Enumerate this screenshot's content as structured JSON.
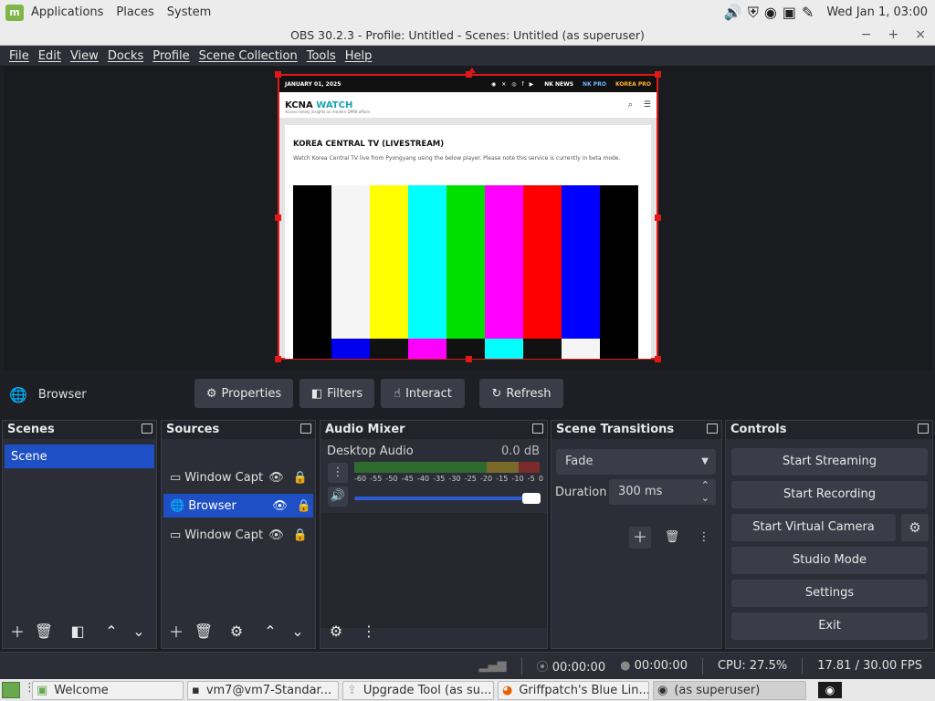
{
  "desktop": {
    "menus": [
      "Applications",
      "Places",
      "System"
    ],
    "clock": "Wed Jan  1, 03:00"
  },
  "window": {
    "title": "OBS 30.2.3 - Profile: Untitled - Scenes: Untitled (as superuser)",
    "controls": [
      "−",
      "+",
      "×"
    ]
  },
  "menubar": [
    "File",
    "Edit",
    "View",
    "Docks",
    "Profile",
    "Scene Collection",
    "Tools",
    "Help"
  ],
  "preview": {
    "website": {
      "date": "JANUARY 01, 2025",
      "brands": [
        "NK NEWS",
        "NK PRO",
        "KOREA PRO"
      ],
      "logo_main": "KCNA",
      "logo_accent": "WATCH",
      "tagline": "Access timely insights on modern DPRK affairs",
      "headline": "KOREA CENTRAL TV (LIVESTREAM)",
      "description": "Watch Korea Central TV live from Pyongyang using the below player. Please note this service is currently in beta mode.",
      "colorbars": [
        "#000000",
        "#f5f5f5",
        "#ffff00",
        "#00ffff",
        "#00e000",
        "#ff00ff",
        "#ff0000",
        "#0000ff",
        "#000000"
      ],
      "colorbars_low": [
        "#000000",
        "#0000ee",
        "#111111",
        "#ff00ff",
        "#111111",
        "#00ffff",
        "#111111",
        "#f5f5f5",
        "#000000"
      ]
    }
  },
  "source_toolbar": {
    "selected_source": "Browser",
    "buttons": {
      "properties": "Properties",
      "filters": "Filters",
      "interact": "Interact",
      "refresh": "Refresh"
    }
  },
  "scenes": {
    "title": "Scenes",
    "items": [
      "Scene"
    ]
  },
  "sources": {
    "title": "Sources",
    "items": [
      {
        "name": "Window Capture",
        "selected": false
      },
      {
        "name": "Browser",
        "selected": true
      },
      {
        "name": "Window Capture",
        "selected": false
      }
    ]
  },
  "audio_mixer": {
    "title": "Audio Mixer",
    "channel": "Desktop Audio",
    "level": "0.0 dB",
    "scale": [
      "-60",
      "-55",
      "-50",
      "-45",
      "-40",
      "-35",
      "-30",
      "-25",
      "-20",
      "-15",
      "-10",
      "-5",
      "0"
    ],
    "volume": 1.0
  },
  "scene_transitions": {
    "title": "Scene Transitions",
    "transition": "Fade",
    "duration_label": "Duration",
    "duration_value": "300 ms"
  },
  "controls": {
    "title": "Controls",
    "buttons": {
      "start_streaming": "Start Streaming",
      "start_recording": "Start Recording",
      "start_virtual_camera": "Start Virtual Camera",
      "studio_mode": "Studio Mode",
      "settings": "Settings",
      "exit": "Exit"
    }
  },
  "statusbar": {
    "stream_time": "00:00:00",
    "record_time": "00:00:00",
    "cpu": "CPU: 27.5%",
    "fps": "17.81 / 30.00 FPS"
  },
  "taskbar": {
    "items": [
      "Welcome",
      "vm7@vm7-Standar...",
      "Upgrade Tool (as su...",
      "Griffpatch's Blue Lin...",
      "(as superuser)"
    ]
  },
  "colors": {
    "accent": "#1f4fc4",
    "selection_outline": "#e01818",
    "dock_bg": "#2b2e36",
    "button_bg": "#3a3d47"
  }
}
